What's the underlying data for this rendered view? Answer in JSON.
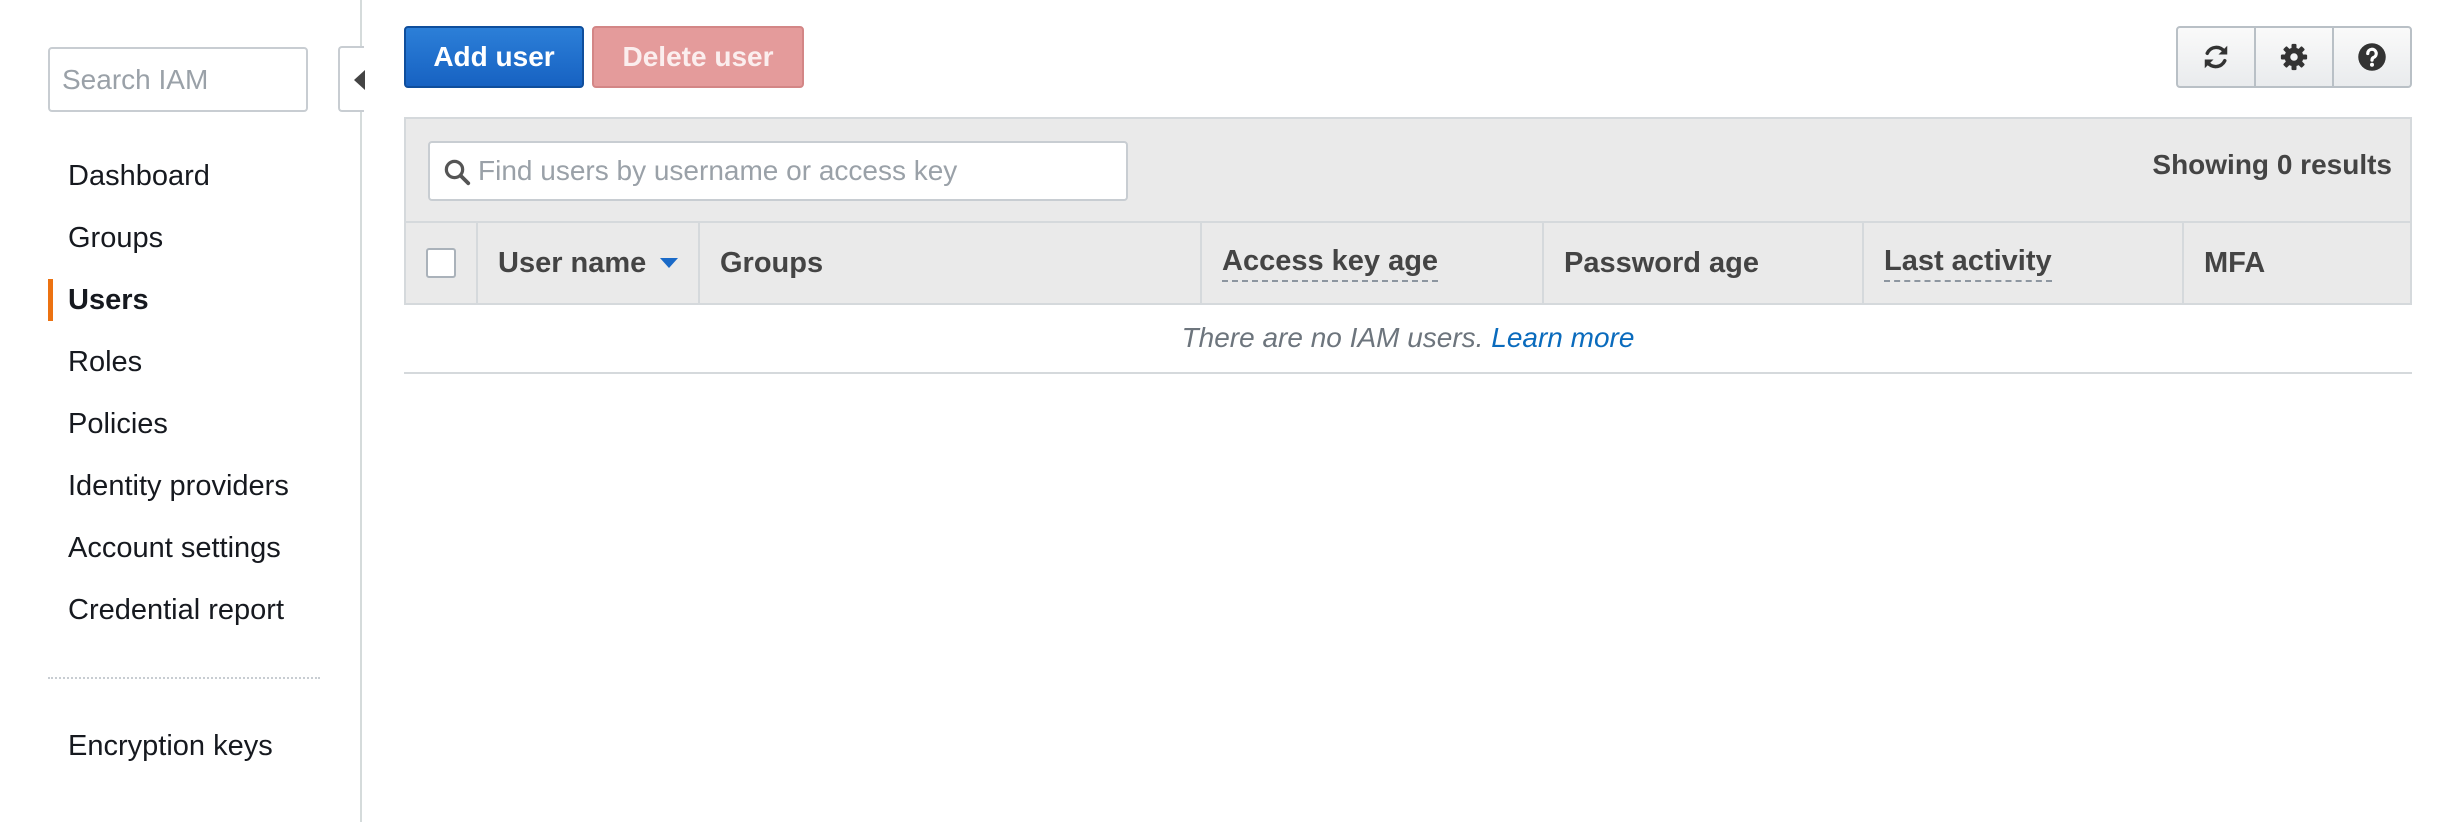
{
  "sidebar": {
    "search_placeholder": "Search IAM",
    "items": [
      {
        "label": "Dashboard"
      },
      {
        "label": "Groups"
      },
      {
        "label": "Users",
        "active": true
      },
      {
        "label": "Roles"
      },
      {
        "label": "Policies"
      },
      {
        "label": "Identity providers"
      },
      {
        "label": "Account settings"
      },
      {
        "label": "Credential report"
      }
    ],
    "extra_items": [
      {
        "label": "Encryption keys"
      }
    ]
  },
  "toolbar": {
    "add_label": "Add user",
    "delete_label": "Delete user",
    "icons": [
      "refresh-icon",
      "gear-icon",
      "help-icon"
    ]
  },
  "table": {
    "filter_placeholder": "Find users by username or access key",
    "results_text": "Showing 0 results",
    "columns": [
      "User name",
      "Groups",
      "Access key age",
      "Password age",
      "Last activity",
      "MFA"
    ],
    "empty_message": "There are no IAM users.",
    "learn_more": "Learn more"
  },
  "colors": {
    "primary": "#1762c2",
    "danger": "#e49b9b",
    "active_marker": "#ec7211",
    "link": "#0a6bbd"
  }
}
